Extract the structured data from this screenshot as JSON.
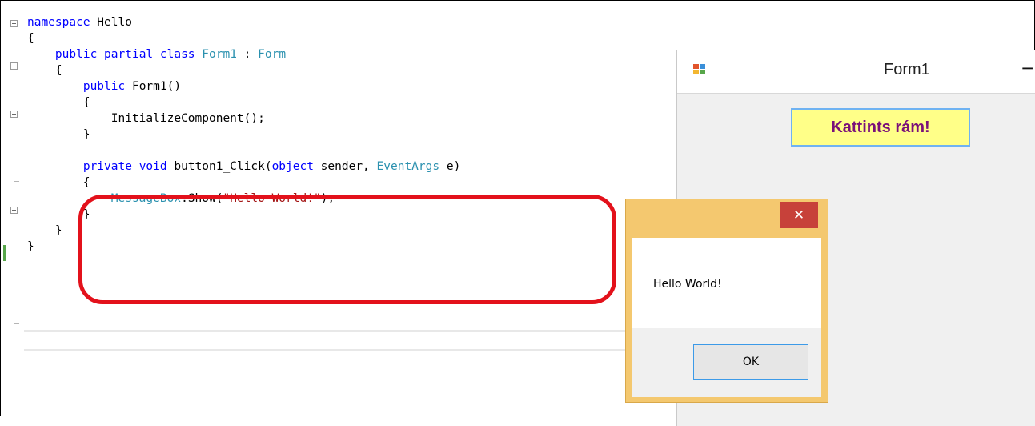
{
  "editor": {
    "lines": [
      {
        "indent": "",
        "tokens": [
          {
            "t": "namespace",
            "c": "kw"
          },
          {
            "t": " Hello",
            "c": ""
          }
        ]
      },
      {
        "indent": "",
        "tokens": [
          {
            "t": "{",
            "c": ""
          }
        ]
      },
      {
        "indent": "    ",
        "tokens": [
          {
            "t": "public",
            "c": "kw"
          },
          {
            "t": " ",
            "c": ""
          },
          {
            "t": "partial",
            "c": "kw"
          },
          {
            "t": " ",
            "c": ""
          },
          {
            "t": "class",
            "c": "kw"
          },
          {
            "t": " ",
            "c": ""
          },
          {
            "t": "Form1",
            "c": "ty"
          },
          {
            "t": " : ",
            "c": ""
          },
          {
            "t": "Form",
            "c": "ty"
          }
        ]
      },
      {
        "indent": "    ",
        "tokens": [
          {
            "t": "{",
            "c": ""
          }
        ]
      },
      {
        "indent": "        ",
        "tokens": [
          {
            "t": "public",
            "c": "kw"
          },
          {
            "t": " Form1()",
            "c": ""
          }
        ]
      },
      {
        "indent": "        ",
        "tokens": [
          {
            "t": "{",
            "c": ""
          }
        ]
      },
      {
        "indent": "            ",
        "tokens": [
          {
            "t": "InitializeComponent();",
            "c": ""
          }
        ]
      },
      {
        "indent": "        ",
        "tokens": [
          {
            "t": "}",
            "c": ""
          }
        ]
      },
      {
        "indent": "",
        "tokens": []
      },
      {
        "indent": "        ",
        "tokens": [
          {
            "t": "private",
            "c": "kw"
          },
          {
            "t": " ",
            "c": ""
          },
          {
            "t": "void",
            "c": "kw"
          },
          {
            "t": " button1_Click(",
            "c": ""
          },
          {
            "t": "object",
            "c": "kw"
          },
          {
            "t": " sender, ",
            "c": ""
          },
          {
            "t": "EventArgs",
            "c": "ty"
          },
          {
            "t": " e)",
            "c": ""
          }
        ]
      },
      {
        "indent": "        ",
        "tokens": [
          {
            "t": "{",
            "c": ""
          }
        ]
      },
      {
        "indent": "            ",
        "tokens": [
          {
            "t": "MessageBox",
            "c": "ty"
          },
          {
            "t": ".Show(",
            "c": ""
          },
          {
            "t": "\"Hello World!\"",
            "c": "st"
          },
          {
            "t": ");",
            "c": ""
          }
        ]
      },
      {
        "indent": "        ",
        "tokens": [
          {
            "t": "}",
            "c": ""
          }
        ]
      },
      {
        "indent": "    ",
        "tokens": [
          {
            "t": "}",
            "c": ""
          }
        ]
      },
      {
        "indent": "",
        "tokens": [
          {
            "t": "}",
            "c": ""
          }
        ]
      }
    ]
  },
  "form1": {
    "title": "Form1",
    "minimize_label": "−",
    "button_label": "Kattints rám!"
  },
  "messagebox": {
    "close_label": "✕",
    "message": "Hello World!",
    "ok_label": "OK"
  },
  "colors": {
    "keyword": "#0000ff",
    "type": "#2b91af",
    "string": "#a31515",
    "highlight": "#e3111b",
    "button_bg": "#ffff88",
    "button_text": "#7a107a",
    "msgbox_frame": "#f4c86f",
    "close_button": "#c7413a"
  }
}
